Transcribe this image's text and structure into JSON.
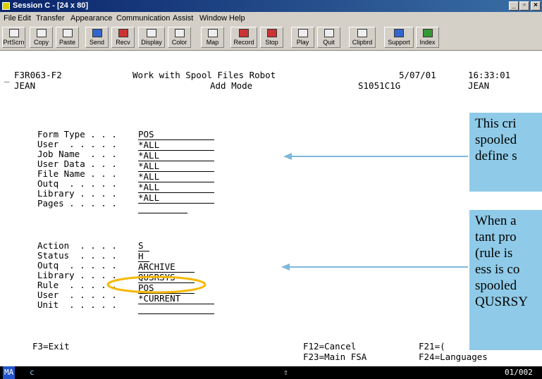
{
  "window": {
    "title": "Session C - [24 x 80]"
  },
  "menu": [
    "File",
    "Edit",
    "Transfer",
    "Appearance",
    "Communication",
    "Assist",
    "Window",
    "Help"
  ],
  "toolbar": [
    "PrtScrn",
    "Copy",
    "Paste",
    "Send",
    "Recv",
    "Display",
    "Color",
    "Map",
    "Record",
    "Stop",
    "Play",
    "Quit",
    "Clipbrd",
    "Support",
    "Index"
  ],
  "screen": {
    "cursor": "_",
    "program": "F3R063-F2",
    "user_top": "JEAN",
    "title": "Work with Spool Files Robot",
    "mode": "Add Mode",
    "date": "5/07/01",
    "time": "16:33:01",
    "system": "S1051C1G",
    "user_right": "JEAN",
    "criteria": [
      {
        "label": "Form Type . . . ",
        "value": "POS"
      },
      {
        "label": "User  . . . . . ",
        "value": "*ALL"
      },
      {
        "label": "Job Name  . . . ",
        "value": "*ALL"
      },
      {
        "label": "User Data . . . ",
        "value": "*ALL"
      },
      {
        "label": "File Name . . . ",
        "value": "*ALL"
      },
      {
        "label": "Outq  . . . . . ",
        "value": "*ALL"
      },
      {
        "label": "Library . . . . ",
        "value": "*ALL"
      },
      {
        "label": "Pages . . . . . ",
        "value": ""
      }
    ],
    "actions": [
      {
        "label": "Action  . . . . ",
        "value": "S"
      },
      {
        "label": "Status  . . . . ",
        "value": "H"
      },
      {
        "label": "Outq  . . . . . ",
        "value": "ARCHIVE"
      },
      {
        "label": "Library . . . . ",
        "value": "QUSRSYS"
      },
      {
        "label": "Rule  . . . . . ",
        "value": "POS"
      },
      {
        "label": "User  . . . . . ",
        "value": "*CURRENT"
      },
      {
        "label": "Unit  . . . . . ",
        "value": ""
      }
    ],
    "fkeys": {
      "f3": "F3=Exit",
      "f12": "F12=Cancel",
      "f23": "F23=Main FSA",
      "f21": "F21=(",
      "f24": "F24=Languages"
    }
  },
  "callouts": {
    "top": [
      "This cri",
      "spooled",
      "define s"
    ],
    "bottom": [
      "When a",
      "tant pro",
      "(rule is",
      "ess is co",
      "spooled",
      "QUSRSY"
    ]
  },
  "status": {
    "left": "MA",
    "mid": "c",
    "arrow": "⇧",
    "right": "01/002"
  },
  "colors": {
    "titlebar": "#0a246a",
    "callout": "#8fcbe8",
    "highlight": "#f5b800",
    "arrow": "#7fb8dc"
  }
}
